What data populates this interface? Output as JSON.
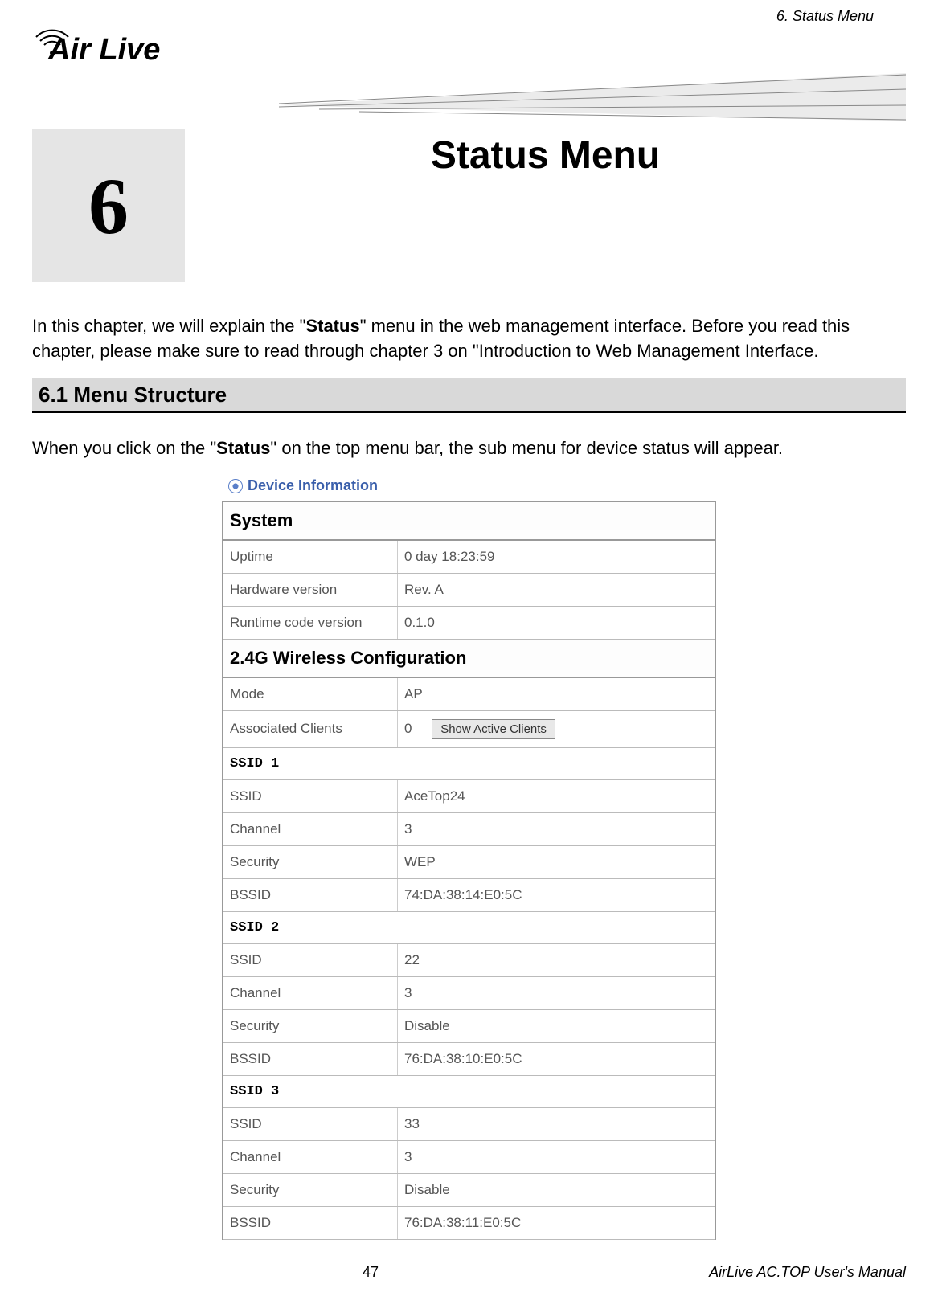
{
  "header": {
    "running_title": "6. Status Menu",
    "logo_text": "Air Live"
  },
  "chapter": {
    "number": "6",
    "title": "Status Menu"
  },
  "intro": {
    "text_pre": "In this chapter, we will explain the \"",
    "text_bold1": "Status",
    "text_mid": "\" menu in the web management interface. Before you read this chapter, please make sure to read through chapter 3 on \"Introduction to Web Management Interface."
  },
  "section_6_1": {
    "heading": "6.1 Menu Structure",
    "text_pre": "When you click on the \"",
    "text_bold": "Status",
    "text_post": "\" on the top menu bar, the sub menu for device status will appear."
  },
  "device_info": {
    "label": "Device Information",
    "system_header": "System",
    "system": {
      "uptime_label": "Uptime",
      "uptime_value": "0 day 18:23:59",
      "hw_label": "Hardware version",
      "hw_value": "Rev. A",
      "rt_label": "Runtime code version",
      "rt_value": "0.1.0"
    },
    "wireless_header": "2.4G Wireless Configuration",
    "wireless": {
      "mode_label": "Mode",
      "mode_value": "AP",
      "assoc_label": "Associated Clients",
      "assoc_value": "0",
      "show_btn": "Show Active Clients"
    },
    "ssid1_header": "SSID 1",
    "ssid1": {
      "ssid_label": "SSID",
      "ssid_value": "AceTop24",
      "channel_label": "Channel",
      "channel_value": "3",
      "security_label": "Security",
      "security_value": "WEP",
      "bssid_label": "BSSID",
      "bssid_value": "74:DA:38:14:E0:5C"
    },
    "ssid2_header": "SSID 2",
    "ssid2": {
      "ssid_label": "SSID",
      "ssid_value": "22",
      "channel_label": "Channel",
      "channel_value": "3",
      "security_label": "Security",
      "security_value": "Disable",
      "bssid_label": "BSSID",
      "bssid_value": "76:DA:38:10:E0:5C"
    },
    "ssid3_header": "SSID 3",
    "ssid3": {
      "ssid_label": "SSID",
      "ssid_value": "33",
      "channel_label": "Channel",
      "channel_value": "3",
      "security_label": "Security",
      "security_value": "Disable",
      "bssid_label": "BSSID",
      "bssid_value": "76:DA:38:11:E0:5C"
    }
  },
  "footer": {
    "page_number": "47",
    "manual_title": "AirLive AC.TOP User's Manual"
  }
}
